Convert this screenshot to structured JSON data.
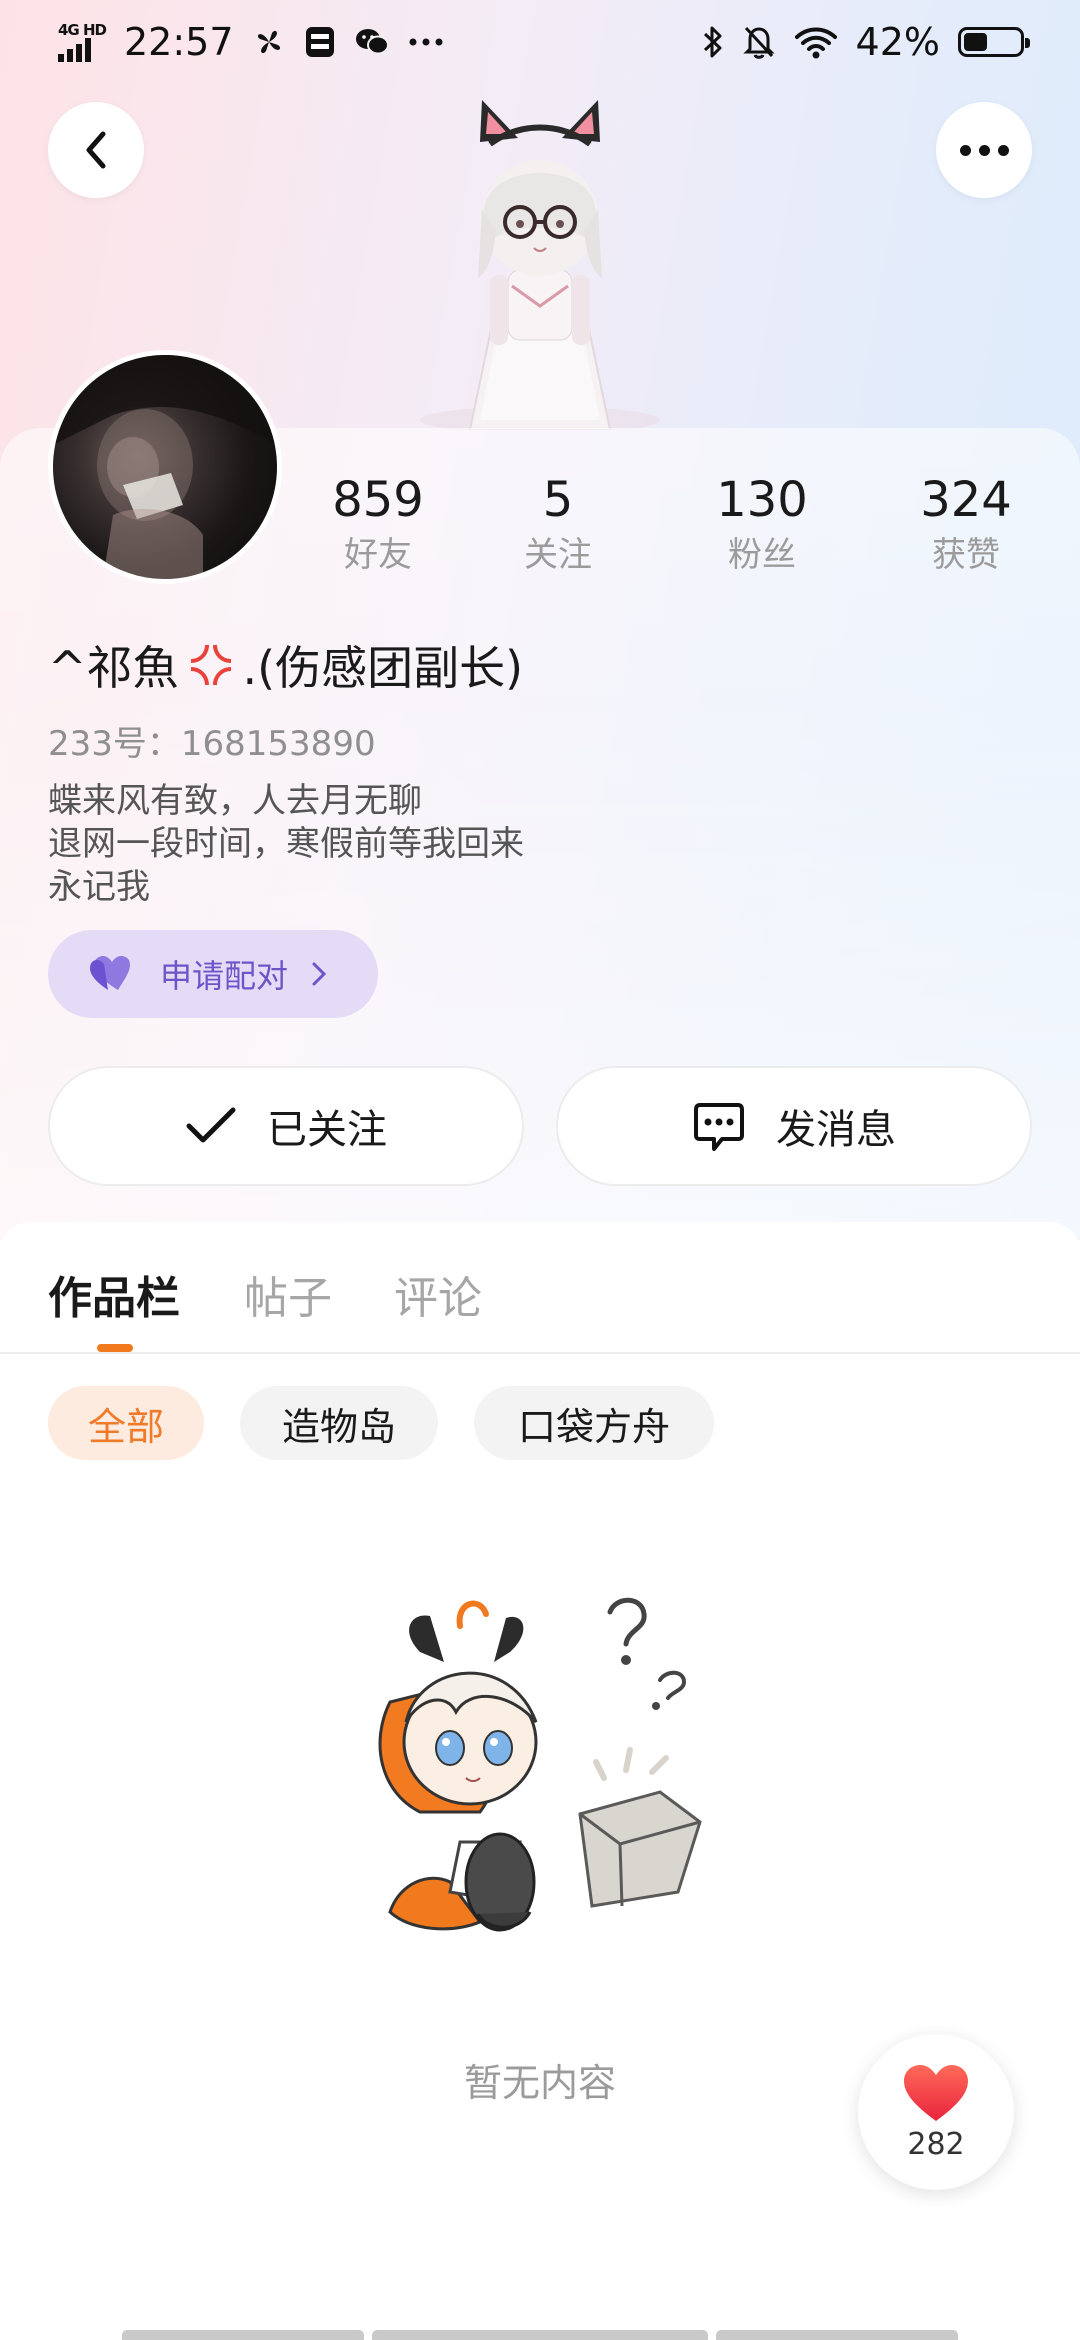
{
  "status_bar": {
    "network": "4G HD",
    "time": "22:57",
    "battery": "42%",
    "battery_level": 0.42,
    "icons": [
      "windmill-icon",
      "sim-card-icon",
      "wechat-icon",
      "more-dots-icon",
      "bluetooth-icon",
      "mute-bell-icon",
      "wifi-icon",
      "battery-icon"
    ]
  },
  "top_bar": {
    "back_icon": "back-arrow-icon",
    "more_icon": "more-horizontal-icon"
  },
  "profile": {
    "stats": [
      {
        "value": "859",
        "label": "好友"
      },
      {
        "value": "5",
        "label": "关注"
      },
      {
        "value": "130",
        "label": "粉丝"
      },
      {
        "value": "324",
        "label": "获赞"
      }
    ],
    "nickname_prefix": "^祁魚",
    "nickname_suffix": ".(伤感团副长)",
    "uid": "233号：168153890",
    "bio": [
      "蝶来风有致，人去月无聊",
      "退网一段时间，寒假前等我回来",
      "永记我"
    ],
    "pair_label": "申请配对",
    "follow_label": "已关注",
    "message_label": "发消息"
  },
  "tabs": [
    "作品栏",
    "帖子",
    "评论"
  ],
  "active_tab": 0,
  "filters": [
    "全部",
    "造物岛",
    "口袋方舟"
  ],
  "active_filter": 0,
  "empty_text": "暂无内容",
  "like": {
    "count": "282"
  },
  "colors": {
    "accent_orange": "#f07a1d",
    "pair_purple": "#6b55c8",
    "pair_bg": "#e4dcf6",
    "like_red": "#ef3b44"
  }
}
